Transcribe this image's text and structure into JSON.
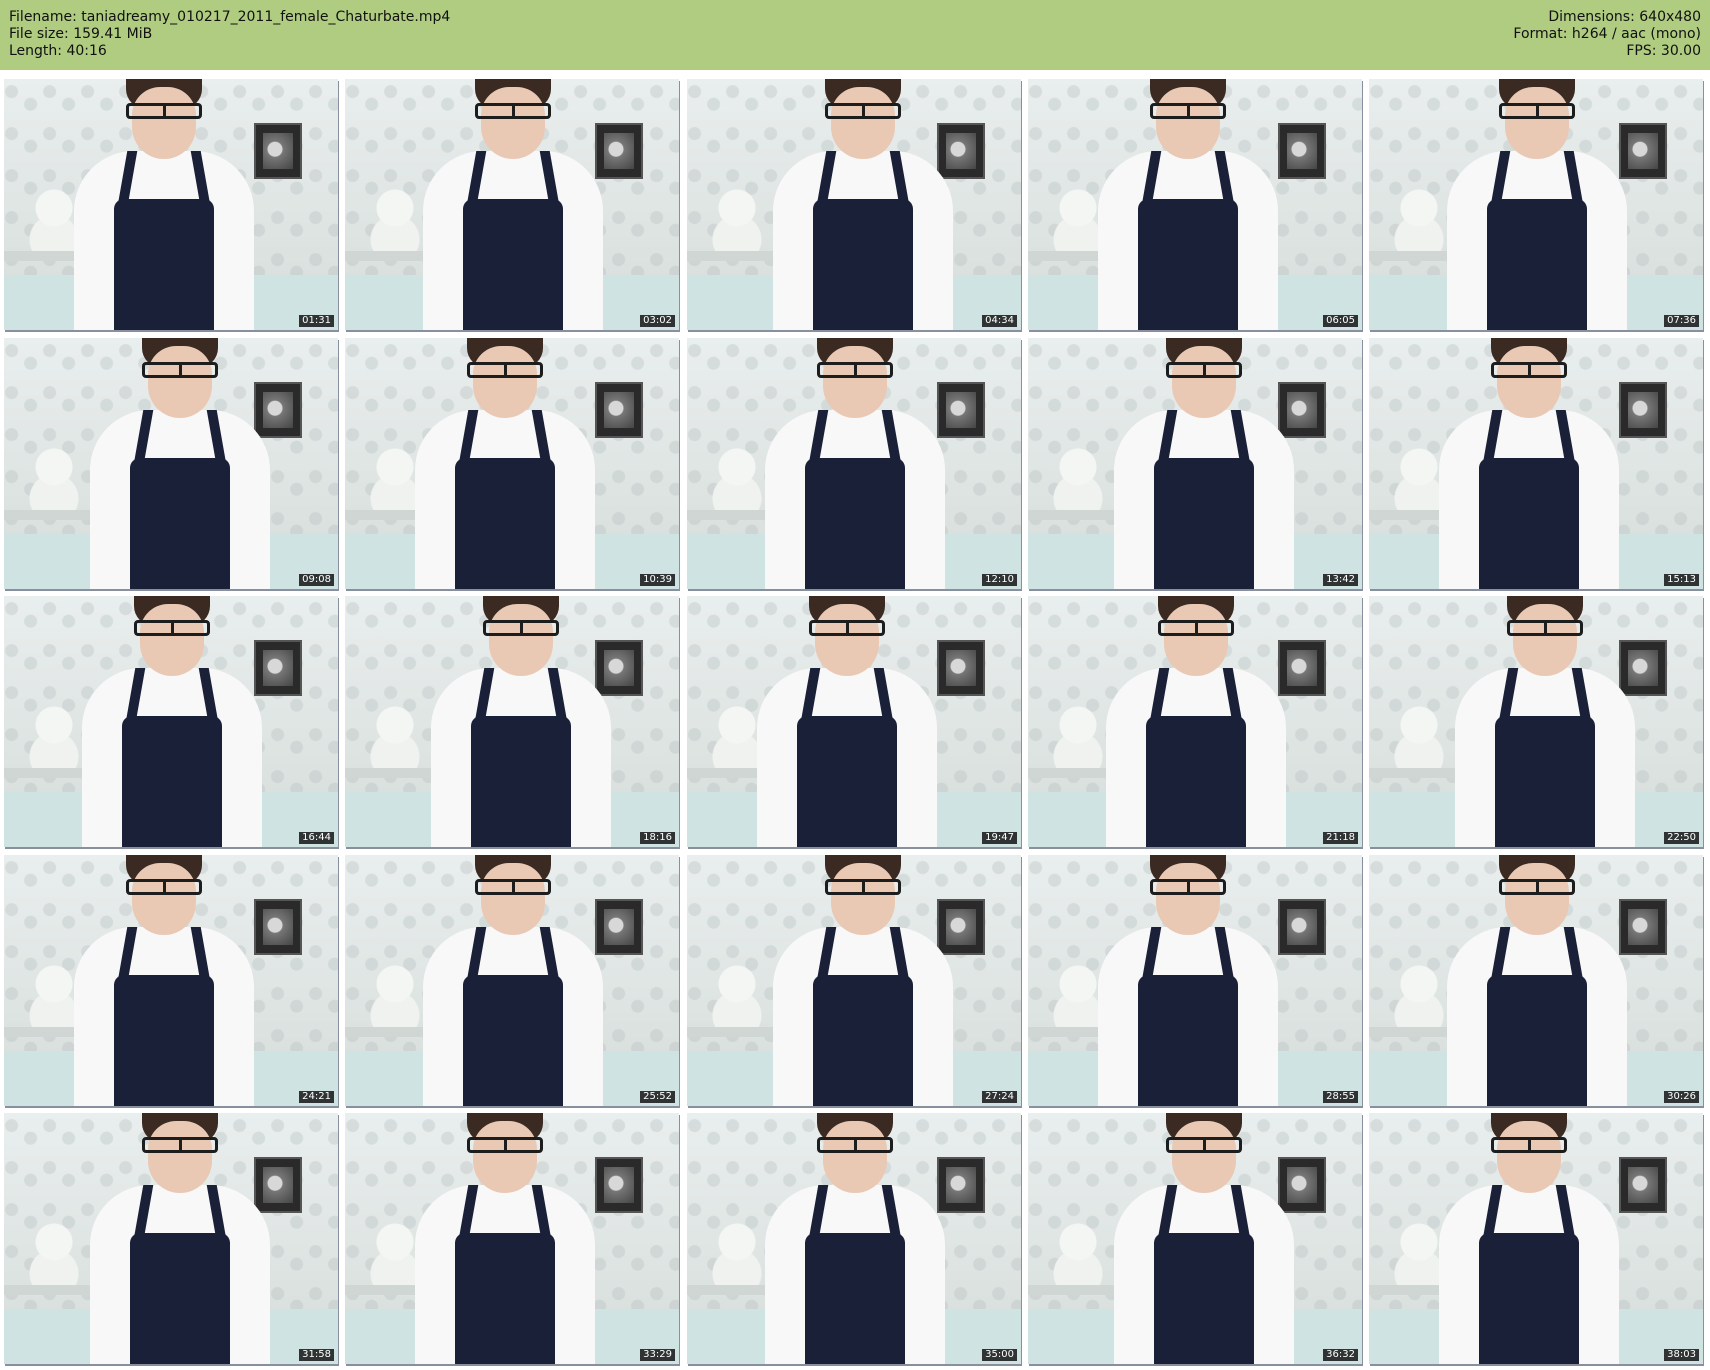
{
  "header": {
    "filename_line": "Filename: taniadreamy_010217_2011_female_Chaturbate.mp4",
    "filesize_line": "File size: 159.41 MiB",
    "length_line": "Length: 40:16",
    "dimensions_line": "Dimensions: 640x480",
    "format_line": "Format: h264 / aac (mono)",
    "fps_line": "FPS: 30.00"
  },
  "colors": {
    "header_background": "#b0cc80",
    "page_background": "#ffffff",
    "timestamp_background": "#141414",
    "pinafore": "#1a2038"
  },
  "thumbnails": [
    {
      "timestamp": "01:31"
    },
    {
      "timestamp": "03:02"
    },
    {
      "timestamp": "04:34"
    },
    {
      "timestamp": "06:05"
    },
    {
      "timestamp": "07:36"
    },
    {
      "timestamp": "09:08"
    },
    {
      "timestamp": "10:39"
    },
    {
      "timestamp": "12:10"
    },
    {
      "timestamp": "13:42"
    },
    {
      "timestamp": "15:13"
    },
    {
      "timestamp": "16:44"
    },
    {
      "timestamp": "18:16"
    },
    {
      "timestamp": "19:47"
    },
    {
      "timestamp": "21:18"
    },
    {
      "timestamp": "22:50"
    },
    {
      "timestamp": "24:21"
    },
    {
      "timestamp": "25:52"
    },
    {
      "timestamp": "27:24"
    },
    {
      "timestamp": "28:55"
    },
    {
      "timestamp": "30:26"
    },
    {
      "timestamp": "31:58"
    },
    {
      "timestamp": "33:29"
    },
    {
      "timestamp": "35:00"
    },
    {
      "timestamp": "36:32"
    },
    {
      "timestamp": "38:03"
    }
  ]
}
